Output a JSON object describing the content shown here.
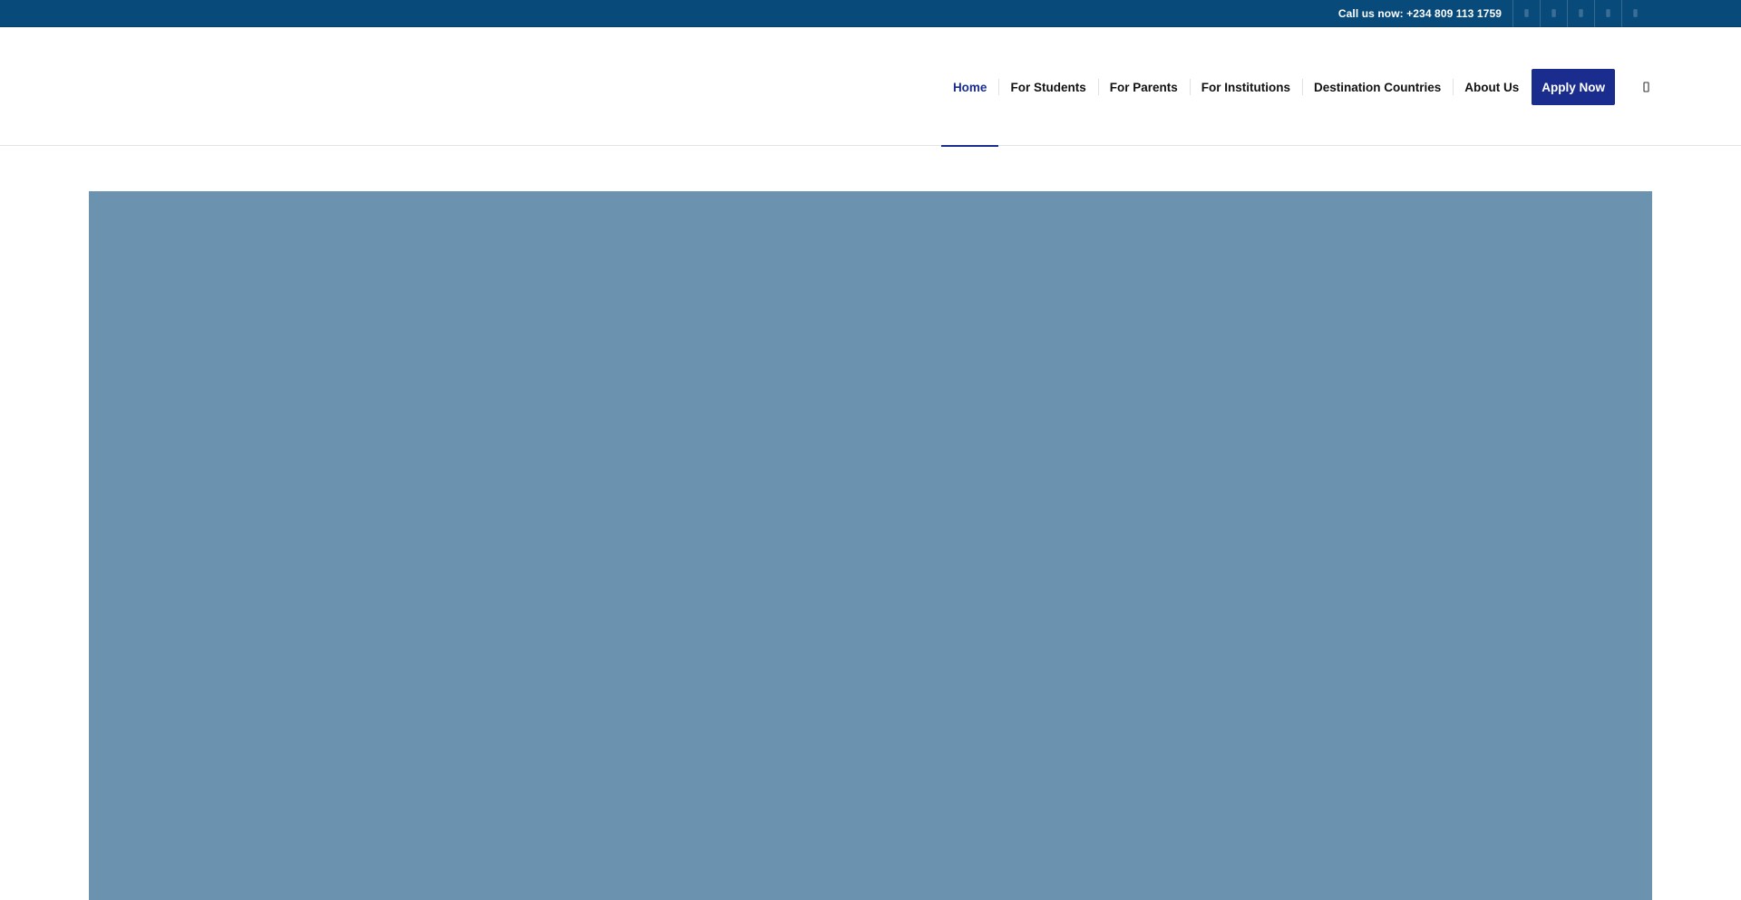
{
  "topbar": {
    "phone_text": "Call us now: +234 809 113 1759",
    "social_icons": [
      "facebook-icon",
      "twitter-icon",
      "instagram-icon",
      "linkedin-icon",
      "whatsapp-icon"
    ]
  },
  "nav": {
    "items": [
      {
        "label": "Home",
        "active": true
      },
      {
        "label": "For Students"
      },
      {
        "label": "For Parents"
      },
      {
        "label": "For Institutions"
      },
      {
        "label": "Destination Countries"
      },
      {
        "label": "About Us"
      }
    ],
    "apply_label": "Apply Now",
    "search_icon": "search-icon"
  },
  "colors": {
    "topbar_bg": "#084b7a",
    "accent": "#1a2d8f",
    "hero_bg": "#6b92af"
  }
}
